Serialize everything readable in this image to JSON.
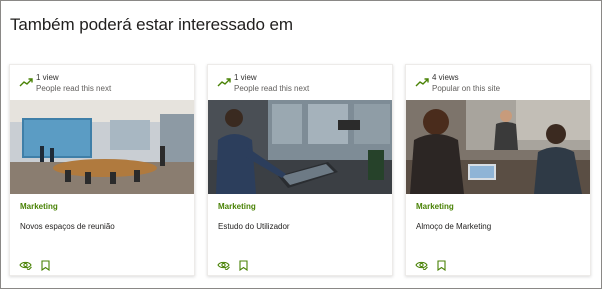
{
  "section": {
    "heading": "Também poderá estar interessado em"
  },
  "colors": {
    "accent_green": "#498205",
    "trend_icon": "#498205",
    "card_border": "#edebe9"
  },
  "cards": [
    {
      "views": "1 view",
      "reason": "People read this next",
      "category": "Marketing",
      "title": "Novos espaços de reunião",
      "image_icon": "meeting-room-photo",
      "actions": [
        "seen-icon",
        "bookmark-icon"
      ]
    },
    {
      "views": "1 view",
      "reason": "People read this next",
      "category": "Marketing",
      "title": "Estudo do Utilizador",
      "image_icon": "user-study-photo",
      "actions": [
        "seen-icon",
        "bookmark-icon"
      ]
    },
    {
      "views": "4 views",
      "reason": "Popular on this site",
      "category": "Marketing",
      "title": "Almoço de Marketing",
      "image_icon": "marketing-lunch-photo",
      "actions": [
        "seen-icon",
        "bookmark-icon"
      ]
    }
  ]
}
